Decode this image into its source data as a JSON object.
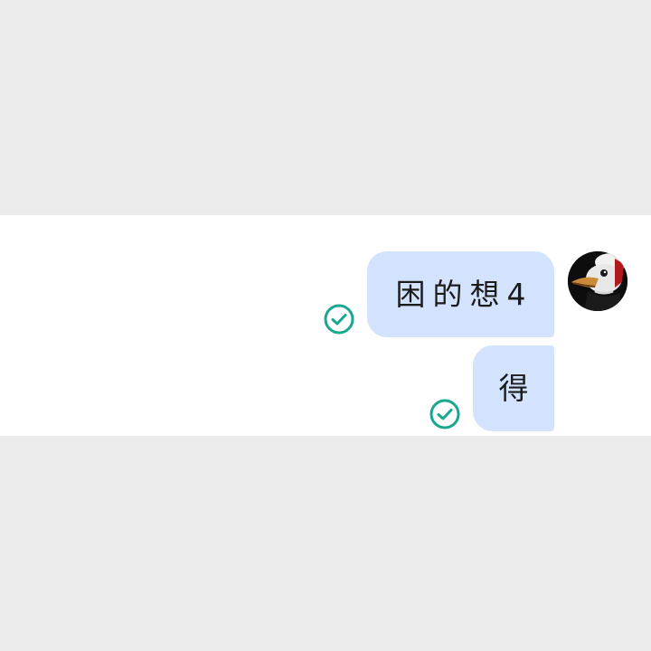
{
  "messages": [
    {
      "text": "困的想4",
      "status": "sent",
      "status_icon": "check-circle-icon"
    },
    {
      "text": "得",
      "status": "sent",
      "status_icon": "check-circle-icon"
    }
  ],
  "colors": {
    "bubble": "#d3e3fd",
    "check": "#1aa78f",
    "backdrop": "#ebebeb",
    "chat_background": "#ffffff"
  },
  "avatar": {
    "icon": "duck-avatar-icon"
  }
}
